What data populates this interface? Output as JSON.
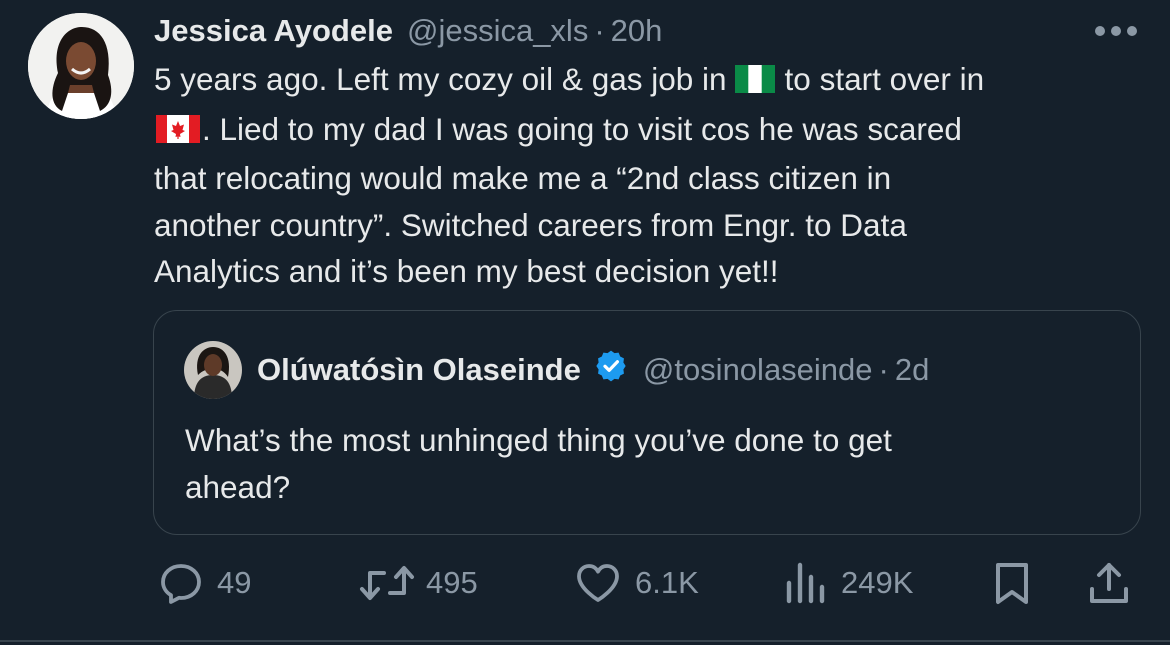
{
  "tweet": {
    "author_name": "Jessica Ayodele",
    "handle": "@jessica_xls",
    "separator": "·",
    "time": "20h",
    "text_lines": [
      [
        "5 years ago. Left my cozy oil & gas job in",
        "to start over in"
      ],
      [
        ". Lied to my dad I was going to visit cos he was scared"
      ],
      [
        "that relocating would make me a “2nd class citizen in"
      ],
      [
        "another country”. Switched careers from Engr. to Data"
      ],
      [
        "Analytics and it’s been my best decision yet!!"
      ]
    ],
    "flags": [
      "nigeria-flag",
      "canada-flag"
    ],
    "avatar_icon": "profile-photo",
    "more_icon": "more-horizontal-icon"
  },
  "quoted_tweet": {
    "author_name": "Olúwatósìn Olaseinde",
    "verified": true,
    "verified_color": "#1d9bf0",
    "handle": "@tosinolaseinde",
    "separator": "·",
    "time": "2d",
    "text_lines": [
      "What’s the most unhinged thing you’ve done to get",
      "ahead?"
    ]
  },
  "actions": {
    "reply": {
      "icon": "reply-icon",
      "count": "49"
    },
    "repost": {
      "icon": "repost-icon",
      "count": "495"
    },
    "like": {
      "icon": "heart-icon",
      "count": "6.1K"
    },
    "views": {
      "icon": "views-icon",
      "count": "249K"
    },
    "bookmark": {
      "icon": "bookmark-icon"
    },
    "share": {
      "icon": "share-icon"
    }
  },
  "colors": {
    "background": "#15202b",
    "text": "#e7e9ea",
    "secondary": "#8b98a5",
    "border": "#38444d",
    "accent": "#1d9bf0"
  }
}
